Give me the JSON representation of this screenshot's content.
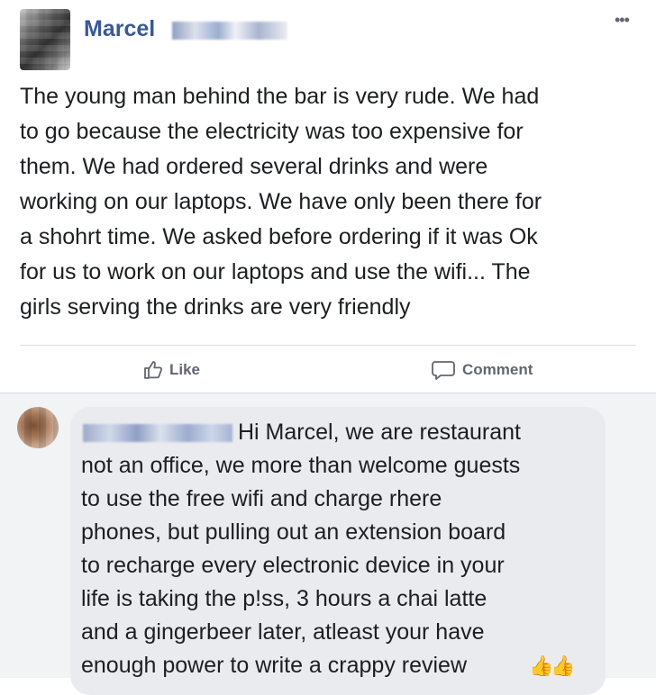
{
  "post": {
    "author": "Marcel",
    "more_glyph": "•••",
    "text": "The young man behind the bar is very rude. We had\nto go because the electricity was too expensive for\nthem. We had ordered several drinks and were\nworking on our laptops. We have only been there for\na shohrt time. We asked before ordering if it was Ok\nfor us to work on our laptops and use the wifi... The\ngirls serving the drinks are very friendly",
    "actions": {
      "like": "Like",
      "comment": "Comment"
    }
  },
  "comment": {
    "text": "Hi Marcel, we are restaurant\nnot an office, we more than welcome guests\nto use the free wifi and charge rhere\nphones, but pulling out an extension board\nto recharge every electronic device in your\nlife is taking the p!ss, 3 hours a chai latte\nand a gingerbeer later, atleast your have\nenough power to write a crappy review",
    "emoji": "👍"
  },
  "colors": {
    "author_blue": "#385898",
    "text": "#1c1e21",
    "muted": "#606770",
    "comment_bg": "#f2f3f5",
    "bubble_bg": "#e9ebee"
  }
}
